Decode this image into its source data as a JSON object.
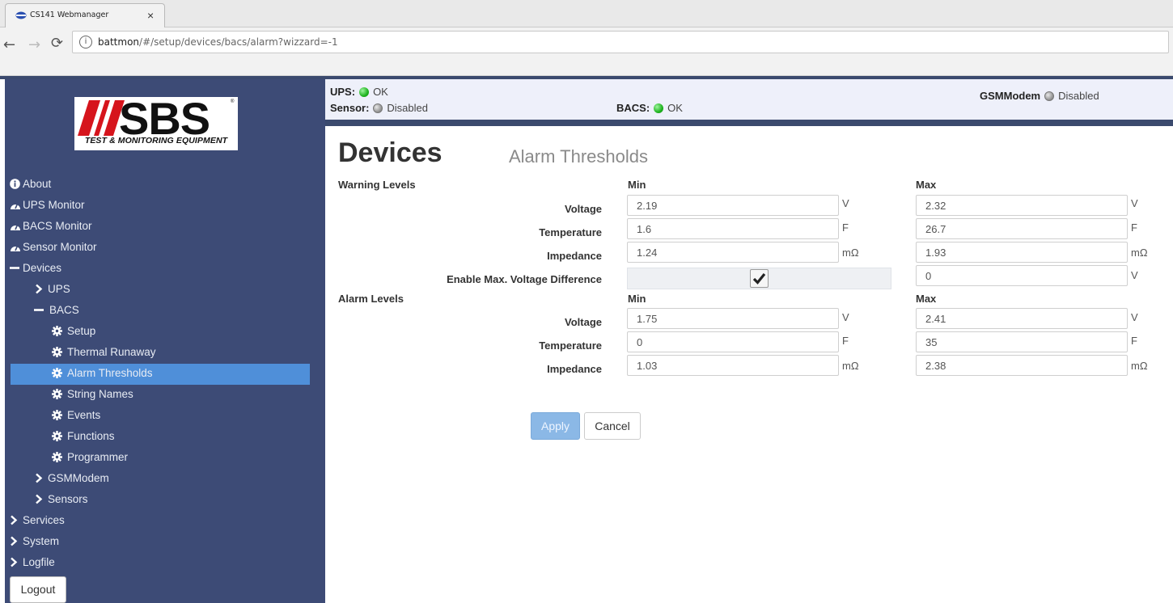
{
  "browser": {
    "tab_title": "CS141 Webmanager",
    "url_host": "battmon",
    "url_path": "/#/setup/devices/bacs/alarm?wizzard=-1"
  },
  "logo": {
    "brand": "SBS",
    "tagline": "TEST & MONITORING EQUIPMENT"
  },
  "nav": {
    "items": [
      {
        "label": "About",
        "icon": "info-icon"
      },
      {
        "label": "UPS Monitor",
        "icon": "dashboard-icon"
      },
      {
        "label": "BACS Monitor",
        "icon": "dashboard-icon"
      },
      {
        "label": "Sensor Monitor",
        "icon": "dashboard-icon"
      },
      {
        "label": "Devices",
        "icon": "minus-icon"
      },
      {
        "label": "UPS",
        "icon": "chevron-right-icon"
      },
      {
        "label": "BACS",
        "icon": "minus-icon"
      },
      {
        "label": "Setup",
        "icon": "gear-icon"
      },
      {
        "label": "Thermal Runaway",
        "icon": "gear-icon"
      },
      {
        "label": "Alarm Thresholds",
        "icon": "gear-icon"
      },
      {
        "label": "String Names",
        "icon": "gear-icon"
      },
      {
        "label": "Events",
        "icon": "gear-icon"
      },
      {
        "label": "Functions",
        "icon": "gear-icon"
      },
      {
        "label": "Programmer",
        "icon": "gear-icon"
      },
      {
        "label": "GSMModem",
        "icon": "chevron-right-icon"
      },
      {
        "label": "Sensors",
        "icon": "chevron-right-icon"
      },
      {
        "label": "Services",
        "icon": "chevron-right-icon"
      },
      {
        "label": "System",
        "icon": "chevron-right-icon"
      },
      {
        "label": "Logfile",
        "icon": "chevron-right-icon"
      }
    ],
    "active": "Alarm Thresholds",
    "logout_label": "Logout"
  },
  "status": {
    "ups_label": "UPS:",
    "ups_value": "OK",
    "sensor_label": "Sensor:",
    "sensor_value": "Disabled",
    "bacs_label": "BACS:",
    "bacs_value": "OK",
    "gsm_label": "GSMModem",
    "gsm_value": "Disabled"
  },
  "page": {
    "title": "Devices",
    "subtitle": "Alarm Thresholds"
  },
  "form": {
    "warning_heading": "Warning Levels",
    "alarm_heading": "Alarm Levels",
    "min_header": "Min",
    "max_header": "Max",
    "warning": {
      "voltage": {
        "label": "Voltage",
        "min": "2.19",
        "max": "2.32",
        "unit": "V"
      },
      "temperature": {
        "label": "Temperature",
        "min": "1.6",
        "max": "26.7",
        "unit": "F"
      },
      "impedance": {
        "label": "Impedance",
        "min": "1.24",
        "max": "1.93",
        "unit": "mΩ"
      }
    },
    "voltage_difference": {
      "label": "Enable Max. Voltage Difference",
      "checked": true,
      "max": "0",
      "unit": "V"
    },
    "alarm": {
      "voltage": {
        "label": "Voltage",
        "min": "1.75",
        "max": "2.41",
        "unit": "V"
      },
      "temperature": {
        "label": "Temperature",
        "min": "0",
        "max": "35",
        "unit": "F"
      },
      "impedance": {
        "label": "Impedance",
        "min": "1.03",
        "max": "2.38",
        "unit": "mΩ"
      }
    },
    "apply_label": "Apply",
    "cancel_label": "Cancel"
  },
  "colors": {
    "sidebar": "#3d4b76",
    "active_item": "#4f8fd9",
    "status_ok": "#1fb31f",
    "status_disabled": "#9a9a9a"
  }
}
